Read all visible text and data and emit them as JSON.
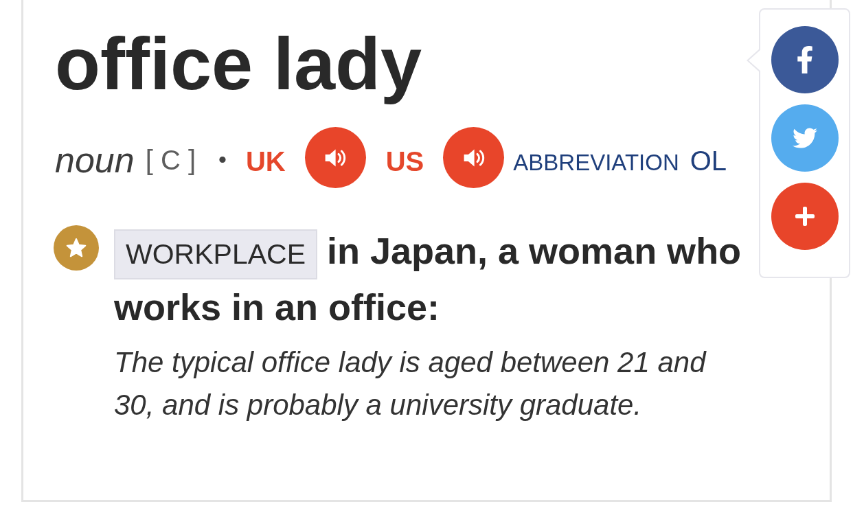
{
  "entry": {
    "headword": "office lady",
    "part_of_speech": "noun",
    "grammar": "[ C ]",
    "separator": "•",
    "pronunciations": [
      {
        "region": "UK"
      },
      {
        "region": "US"
      }
    ],
    "abbreviation": {
      "label": "ABBREVIATION",
      "value": "OL"
    },
    "senses": [
      {
        "domain": "WORKPLACE",
        "definition": "in Japan, a woman who works in an office:",
        "examples": [
          "The typical office lady is aged between 21 and 30, and is probably a university graduate."
        ]
      }
    ]
  },
  "share_buttons": [
    {
      "kind": "facebook"
    },
    {
      "kind": "twitter"
    },
    {
      "kind": "more"
    }
  ]
}
